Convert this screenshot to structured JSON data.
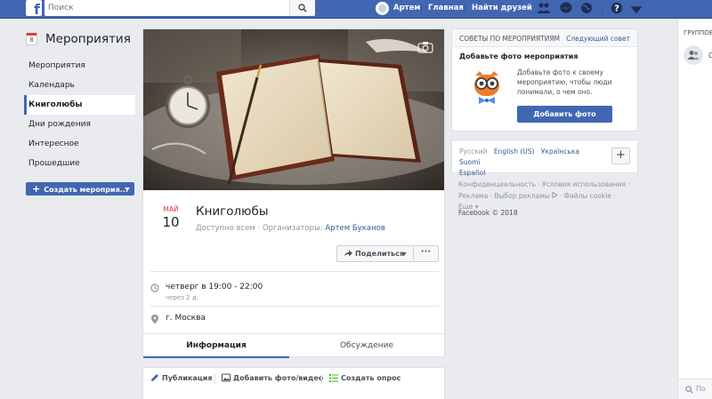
{
  "topbar": {
    "logo": "f",
    "search_placeholder": "Поиск",
    "user_name": "Артем",
    "home_link": "Главная",
    "find_friends_link": "Найти друзей",
    "brand_color": "#4267b2"
  },
  "sidebar": {
    "title": "Мероприятия",
    "calendar_day": "8",
    "items": [
      {
        "label": "Мероприятия"
      },
      {
        "label": "Календарь"
      },
      {
        "label": "Книголюбы"
      },
      {
        "label": "Дни рождения"
      },
      {
        "label": "Интересное"
      },
      {
        "label": "Прошедшие"
      }
    ],
    "active_item": "Книголюбы",
    "create_button": "Создать мероприя..."
  },
  "event": {
    "month": "МАЙ",
    "day": "10",
    "title": "Книголюбы",
    "visibility": "Доступно всем",
    "separator": "·",
    "organizers_label": "Организаторы:",
    "organizer": "Артем Буканов",
    "share_button": "Поделиться",
    "more_button": "···",
    "time": "четверг в 19:00 - 22:00",
    "time_relative": "через 2 д.",
    "location": "г. Москва",
    "tabs": [
      {
        "label": "Информация",
        "active": true
      },
      {
        "label": "Обсуждение",
        "active": false
      }
    ]
  },
  "composer": {
    "post": "Публикация",
    "add_photo": "Добавить фото/видео",
    "create_poll": "Создать опрос"
  },
  "tips": {
    "header": "СОВЕТЫ ПО МЕРОПРИЯТИЯМ",
    "next_link": "Следующий совет",
    "subtitle": "Добавьте фото мероприятия",
    "text": "Добавьте фото к своему мероприятию, чтобы люди понимали, о чем оно.",
    "button": "Добавить фото"
  },
  "languages": {
    "current": "Русский",
    "others": [
      "English (US)",
      "Українська",
      "Suomi",
      "Español"
    ],
    "add": "+"
  },
  "footer": {
    "links": [
      "Конфиденциальность",
      "Условия использования",
      "Реклама",
      "Выбор рекламы",
      "Файлы cookie",
      "Еще"
    ],
    "copyright": "Facebook © 2018"
  },
  "chat": {
    "title": "ГРУППОВ",
    "group_initial": "С",
    "search_placeholder": "По"
  }
}
